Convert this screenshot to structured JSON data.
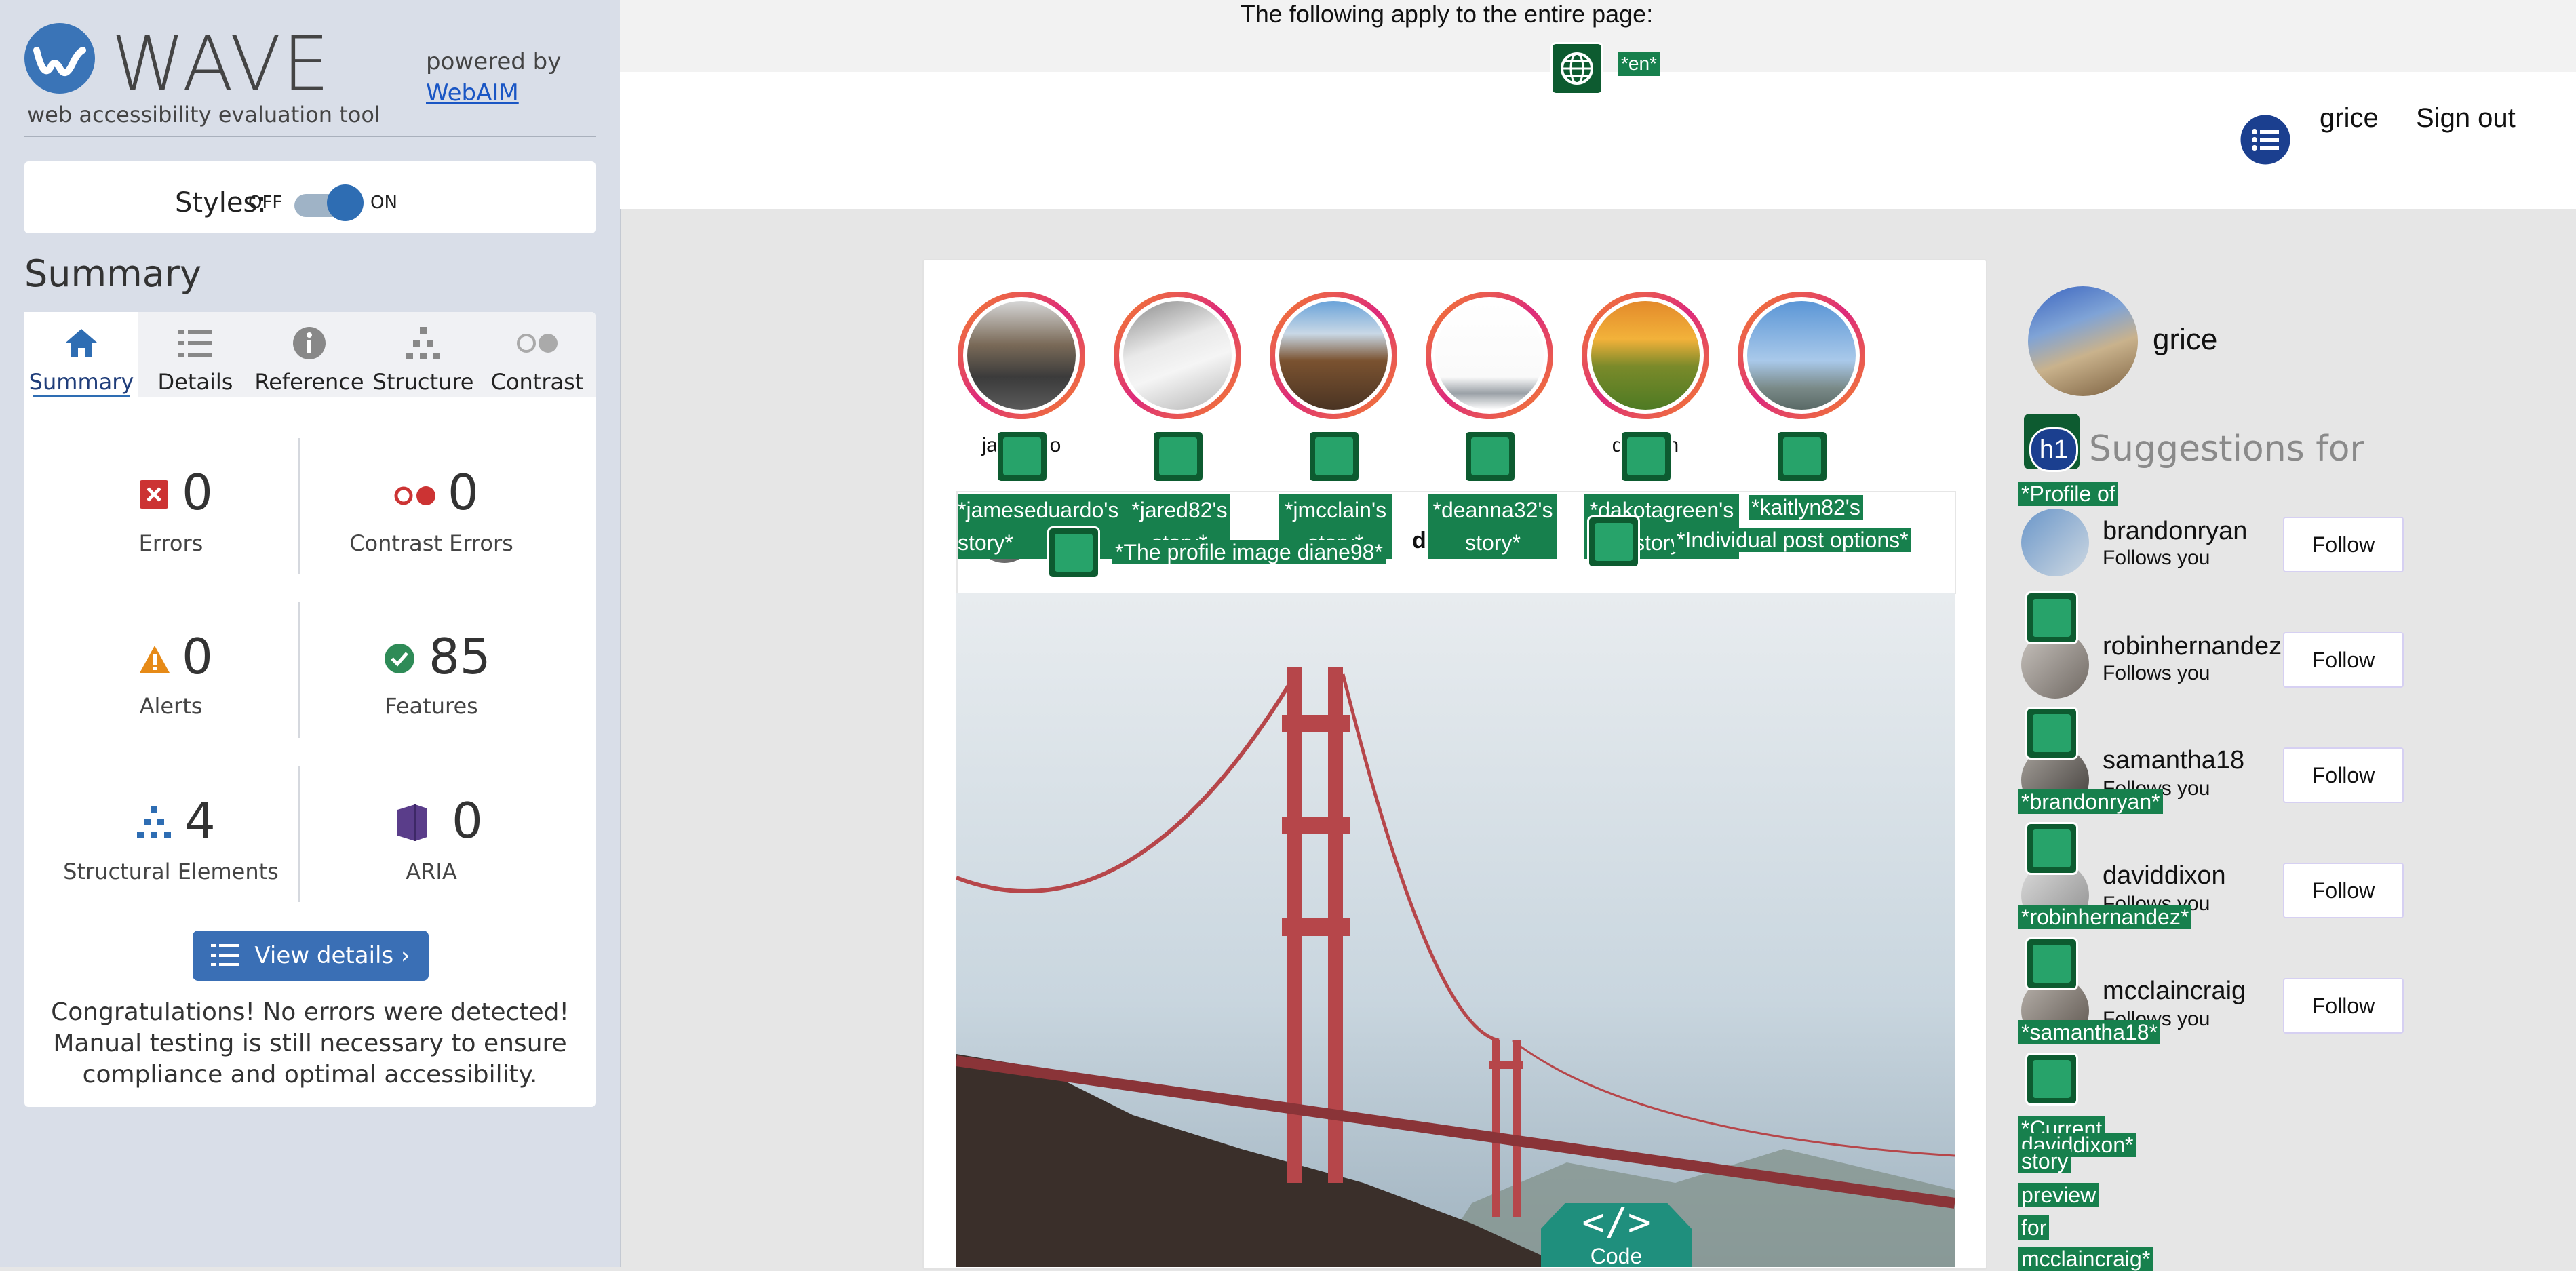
{
  "wave": {
    "logo_text": "WAVE",
    "logo_sub": "web accessibility evaluation tool",
    "powered_by": "powered by",
    "webaim": "WebAIM",
    "styles_label": "Styles:",
    "toggle_off": "OFF",
    "toggle_on": "ON",
    "summary_title": "Summary",
    "tabs": [
      {
        "label": "Summary",
        "icon": "home-icon"
      },
      {
        "label": "Details",
        "icon": "list-icon"
      },
      {
        "label": "Reference",
        "icon": "info-icon"
      },
      {
        "label": "Structure",
        "icon": "hierarchy-icon"
      },
      {
        "label": "Contrast",
        "icon": "contrast-icon"
      }
    ],
    "stats": {
      "errors": {
        "value": "0",
        "label": "Errors"
      },
      "contrast_errors": {
        "value": "0",
        "label": "Contrast Errors"
      },
      "alerts": {
        "value": "0",
        "label": "Alerts"
      },
      "features": {
        "value": "85",
        "label": "Features"
      },
      "structural": {
        "value": "4",
        "label": "Structural Elements"
      },
      "aria": {
        "value": "0",
        "label": "ARIA"
      }
    },
    "view_details": "View details ›",
    "congrats": "Congratulations! No errors were detected! Manual testing is still necessary to ensure compliance and optimal accessibility."
  },
  "page": {
    "apply_text": "The following apply to the entire page:",
    "lang_tag": "*en*",
    "user": "grice",
    "sign_out": "Sign out",
    "stories": [
      {
        "name": "jam     ardo",
        "tag": "*jameseduardo's story*"
      },
      {
        "name": "j         2",
        "tag": "*jared82's story*"
      },
      {
        "name": "j         n",
        "tag": "*jmcclain's story*"
      },
      {
        "name": "de       32",
        "tag": "*deanna32's story*"
      },
      {
        "name": "dal       een",
        "tag": "*dakotagreen's story*"
      },
      {
        "name": "k         2",
        "tag": "*kaitlyn82's"
      }
    ],
    "post_profile_tag": "*The profile image diane98*",
    "post_user": "dian",
    "post_options_tag": "*Individual post options*",
    "code_label": "Code",
    "profile_name": "grice",
    "h1_badge": "h1",
    "suggestions_heading": "Suggestions for",
    "suggestions": [
      {
        "name": "brandonryan",
        "sub": "Follows you",
        "button": "Follow"
      },
      {
        "name": "robinhernandez",
        "sub": "Follows you",
        "button": "Follow"
      },
      {
        "name": "samantha18",
        "sub": "Follows you",
        "button": "Follow"
      },
      {
        "name": "daviddixon",
        "sub": "Follows you",
        "button": "Follow"
      },
      {
        "name": "mcclaincraig",
        "sub": "Follows you",
        "button": "Follow"
      }
    ],
    "sidebar_tags": [
      "*Profile of",
      "*brandonryan*",
      "*robinhernandez*",
      "*samantha18*",
      "*Current",
      "daviddixon*",
      "story",
      "preview",
      "for",
      "mcclaincraig*"
    ]
  }
}
